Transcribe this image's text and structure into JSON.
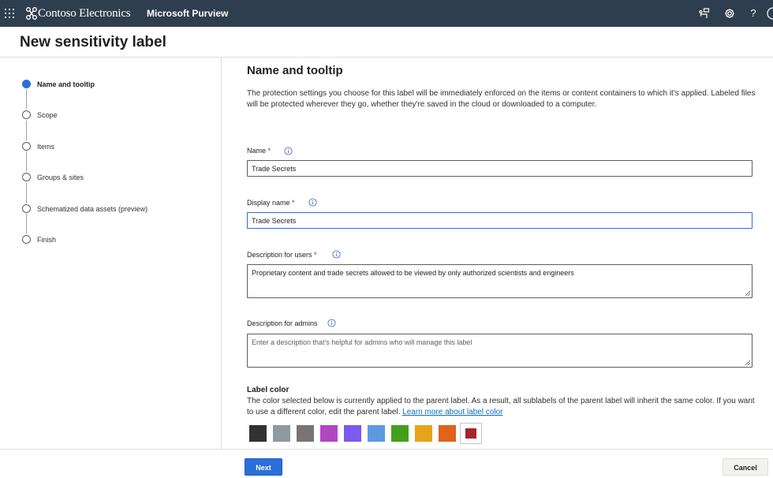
{
  "topbar": {
    "brand": "Contoso Electronics",
    "app_name": "Microsoft Purview",
    "icons": [
      "waffle-icon",
      "contoso-logo-icon",
      "workflow-icon",
      "gear-icon",
      "help-icon",
      "account-icon"
    ],
    "help_glyph": "?",
    "background": "#2f3e4f"
  },
  "page": {
    "title": "New sensitivity label"
  },
  "steps": [
    {
      "label": "Name and tooltip",
      "state": "current"
    },
    {
      "label": "Scope",
      "state": "upcoming"
    },
    {
      "label": "Items",
      "state": "upcoming"
    },
    {
      "label": "Groups & sites",
      "state": "upcoming"
    },
    {
      "label": "Schematized data assets (preview)",
      "state": "upcoming"
    },
    {
      "label": "Finish",
      "state": "upcoming"
    }
  ],
  "main": {
    "heading": "Name and tooltip",
    "intro": "The protection settings you choose for this label will be immediately enforced on the items or content containers to which it's applied. Labeled files will be protected wherever they go, whether they're saved in the cloud or downloaded to a computer.",
    "fields": {
      "name": {
        "label": "Name",
        "required": "*",
        "value": "Trade Secrets"
      },
      "display_name": {
        "label": "Display name",
        "required": "*",
        "value": "Trade Secrets"
      },
      "desc_users": {
        "label": "Description for users",
        "required": "*",
        "value": "Proprietary content and trade secrets allowed to be viewed by only authorized scientists and engineers"
      },
      "desc_admins": {
        "label": "Description for admins",
        "placeholder": "Enter a description that's helpful for admins who will manage this label"
      }
    },
    "label_color": {
      "title": "Label color",
      "description": "The color selected below is currently applied to the parent label. As a result, all sublabels of the parent label will inherit the same color. If you want to use a different color, edit the parent label. ",
      "link": "Learn more about label color",
      "swatches": [
        "#323232",
        "#8d9aa0",
        "#7a7574",
        "#b146c2",
        "#7a5af0",
        "#5c9ae0",
        "#41a11a",
        "#e6a41c",
        "#e0621b",
        "#a4262c"
      ],
      "selected": "#a4262c"
    }
  },
  "footer": {
    "next": "Next",
    "cancel": "Cancel"
  },
  "colors": {
    "accent": "#2b6fd6",
    "required": "#a4262c",
    "link": "#0f6cbd"
  }
}
